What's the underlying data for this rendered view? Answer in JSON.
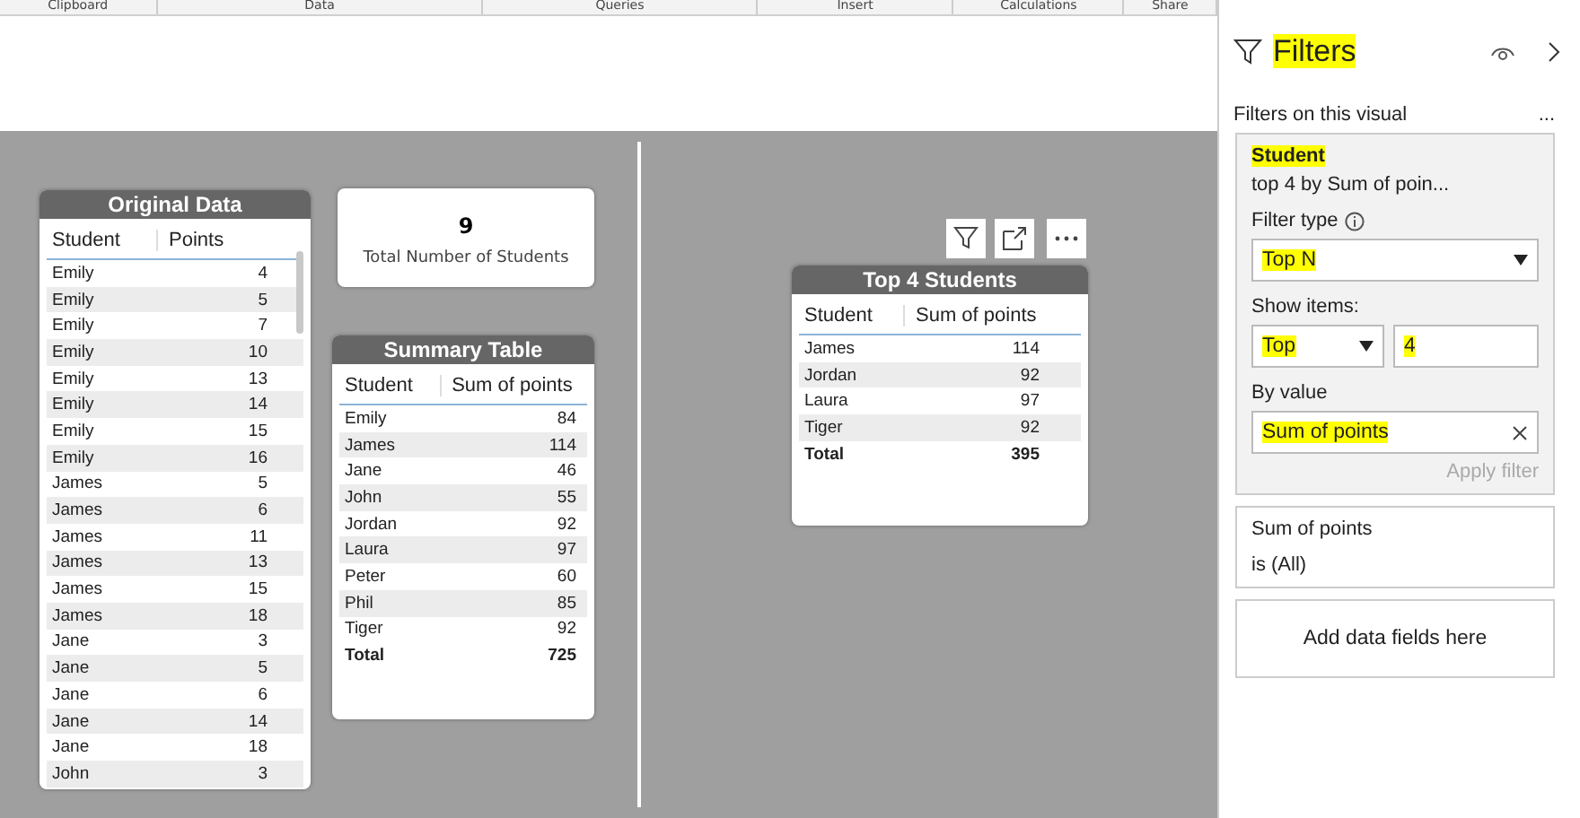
{
  "ribbon": {
    "groups": [
      "Clipboard",
      "Data",
      "Queries",
      "Insert",
      "Calculations",
      "Share"
    ]
  },
  "original_data": {
    "title": "Original Data",
    "columns": [
      "Student",
      "Points"
    ],
    "rows": [
      [
        "Emily",
        "4"
      ],
      [
        "Emily",
        "5"
      ],
      [
        "Emily",
        "7"
      ],
      [
        "Emily",
        "10"
      ],
      [
        "Emily",
        "13"
      ],
      [
        "Emily",
        "14"
      ],
      [
        "Emily",
        "15"
      ],
      [
        "Emily",
        "16"
      ],
      [
        "James",
        "5"
      ],
      [
        "James",
        "6"
      ],
      [
        "James",
        "11"
      ],
      [
        "James",
        "13"
      ],
      [
        "James",
        "15"
      ],
      [
        "James",
        "18"
      ],
      [
        "Jane",
        "3"
      ],
      [
        "Jane",
        "5"
      ],
      [
        "Jane",
        "6"
      ],
      [
        "Jane",
        "14"
      ],
      [
        "Jane",
        "18"
      ],
      [
        "John",
        "3"
      ]
    ]
  },
  "card": {
    "value": "9",
    "label": "Total Number of Students"
  },
  "summary_table": {
    "title": "Summary Table",
    "columns": [
      "Student",
      "Sum of points"
    ],
    "rows": [
      [
        "Emily",
        "84"
      ],
      [
        "James",
        "114"
      ],
      [
        "Jane",
        "46"
      ],
      [
        "John",
        "55"
      ],
      [
        "Jordan",
        "92"
      ],
      [
        "Laura",
        "97"
      ],
      [
        "Peter",
        "60"
      ],
      [
        "Phil",
        "85"
      ],
      [
        "Tiger",
        "92"
      ]
    ],
    "total": [
      "Total",
      "725"
    ]
  },
  "top_table": {
    "title": "Top 4 Students",
    "columns": [
      "Student",
      "Sum of points"
    ],
    "rows": [
      [
        "James",
        "114"
      ],
      [
        "Jordan",
        "92"
      ],
      [
        "Laura",
        "97"
      ],
      [
        "Tiger",
        "92"
      ]
    ],
    "total": [
      "Total",
      "395"
    ]
  },
  "filters": {
    "title": "Filters",
    "title_highlighted": true,
    "section": "Filters on this visual",
    "more": "...",
    "student_filter": {
      "field": "Student",
      "field_highlighted": true,
      "summary": "top 4 by Sum of poin...",
      "filter_type_label": "Filter type",
      "filter_type": {
        "value": "Top N",
        "highlighted": true
      },
      "show_items_label": "Show items:",
      "direction": {
        "value": "Top",
        "highlighted": true
      },
      "count": {
        "value": "4",
        "highlighted": true
      },
      "by_value_label": "By value",
      "by_value": {
        "value": "Sum of points",
        "highlighted": true
      },
      "apply": "Apply filter"
    },
    "other_filter": {
      "field": "Sum of points",
      "summary": "is (All)"
    },
    "add_fields": "Add data fields here"
  }
}
